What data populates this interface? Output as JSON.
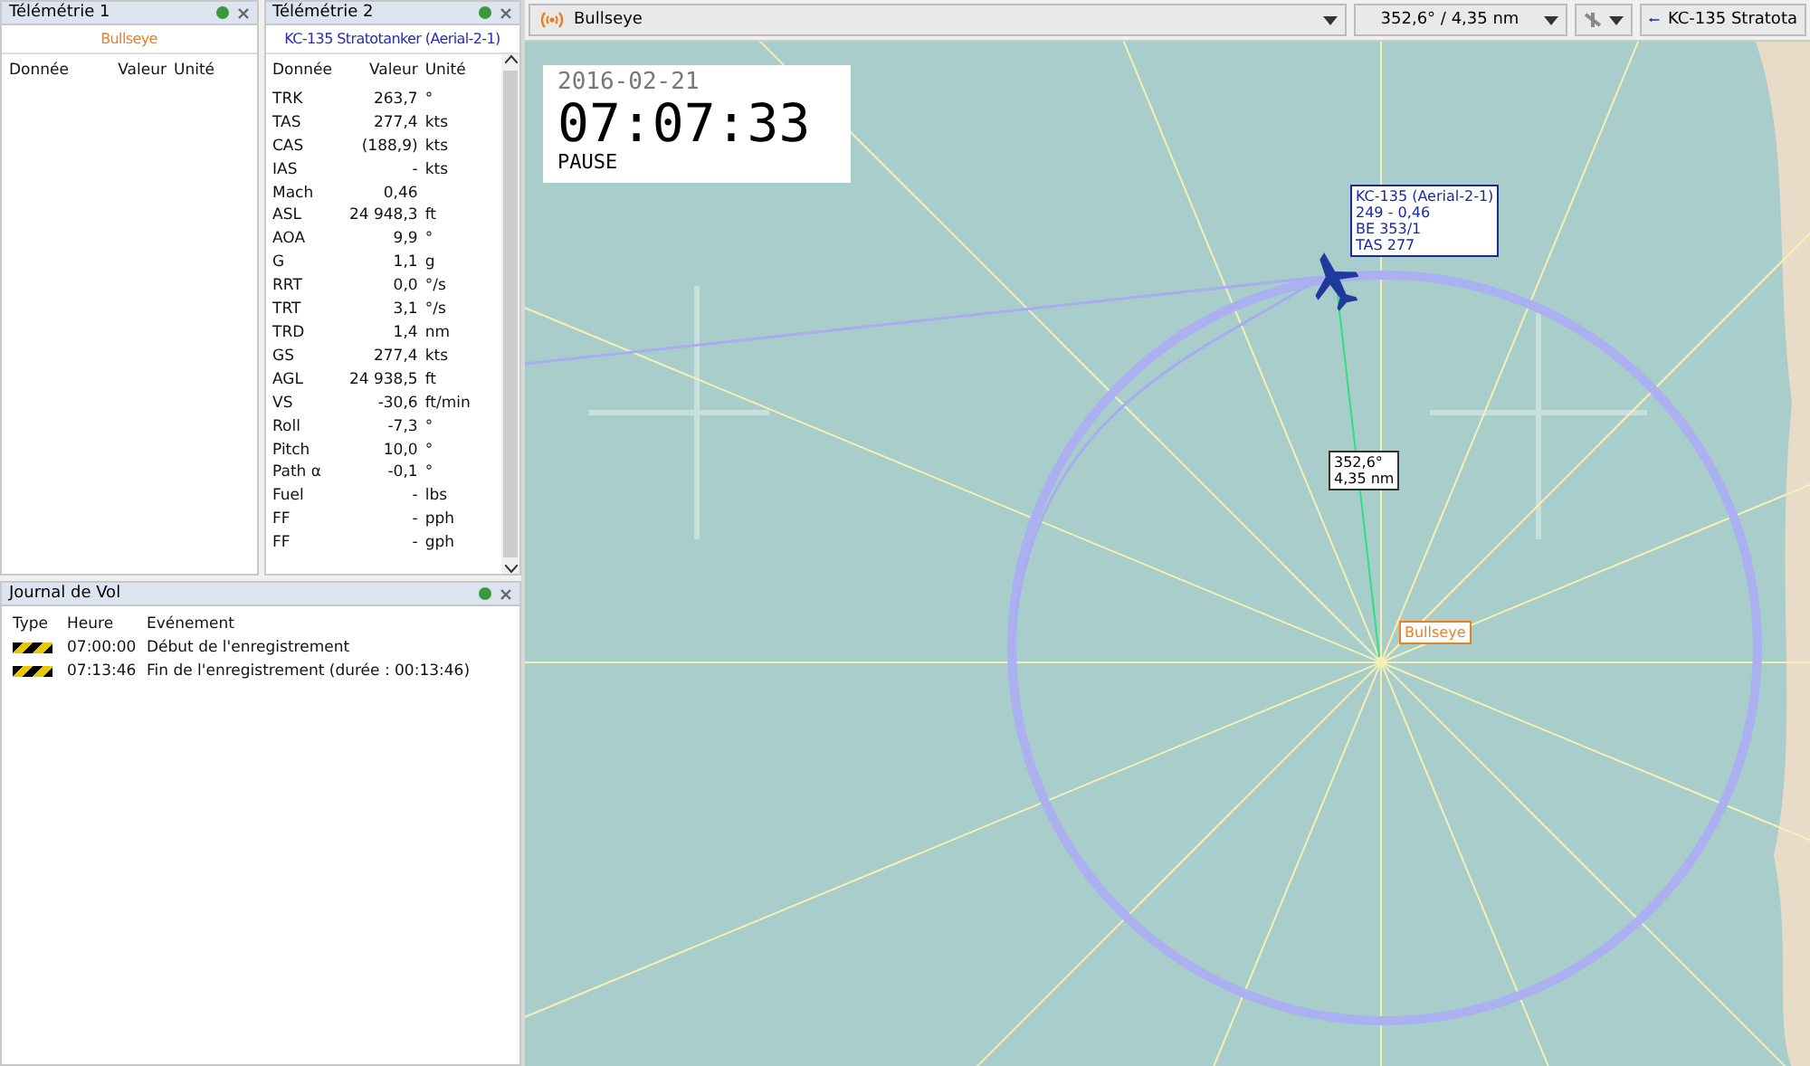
{
  "telemetry_1": {
    "title": "Télémétrie 1",
    "target": "Bullseye",
    "columns": [
      "Donnée",
      "Valeur",
      "Unité"
    ]
  },
  "telemetry_2": {
    "title": "Télémétrie 2",
    "target": "KC-135 Stratotanker (Aerial-2-1)",
    "columns": [
      "Donnée",
      "Valeur",
      "Unité"
    ],
    "rows": [
      {
        "data": "TRK",
        "value": "263,7",
        "unit": "°"
      },
      {
        "data": "TAS",
        "value": "277,4",
        "unit": "kts"
      },
      {
        "data": "CAS",
        "value": "(188,9)",
        "unit": "kts"
      },
      {
        "data": "IAS",
        "value": "-",
        "unit": "kts"
      },
      {
        "data": "Mach",
        "value": "0,46",
        "unit": ""
      },
      {
        "data": "ASL",
        "value": "24 948,3",
        "unit": "ft"
      },
      {
        "data": "AOA",
        "value": "9,9",
        "unit": "°"
      },
      {
        "data": "G",
        "value": "1,1",
        "unit": "g"
      },
      {
        "data": "RRT",
        "value": "0,0",
        "unit": "°/s"
      },
      {
        "data": "TRT",
        "value": "3,1",
        "unit": "°/s"
      },
      {
        "data": "TRD",
        "value": "1,4",
        "unit": "nm"
      },
      {
        "data": "GS",
        "value": "277,4",
        "unit": "kts"
      },
      {
        "data": "AGL",
        "value": "24 938,5",
        "unit": "ft"
      },
      {
        "data": "VS",
        "value": "-30,6",
        "unit": "ft/min"
      },
      {
        "data": "Roll",
        "value": "-7,3",
        "unit": "°"
      },
      {
        "data": "Pitch",
        "value": "10,0",
        "unit": "°"
      },
      {
        "data": "Path α",
        "value": "-0,1",
        "unit": "°"
      },
      {
        "data": "Fuel",
        "value": "-",
        "unit": "lbs"
      },
      {
        "data": "FF",
        "value": "-",
        "unit": "pph"
      },
      {
        "data": "FF",
        "value": "-",
        "unit": "gph"
      }
    ]
  },
  "flight_log": {
    "title": "Journal de Vol",
    "columns": [
      "Type",
      "Heure",
      "Evénement"
    ],
    "rows": [
      {
        "time": "07:00:00",
        "event": "Début de l'enregistrement"
      },
      {
        "time": "07:13:46",
        "event": "Fin de l'enregistrement (durée : 00:13:46)"
      }
    ]
  },
  "toolbar": {
    "reference": "Bullseye",
    "bearing": "352,6° / 4,35 nm",
    "aircraft": "KC-135 Stratota"
  },
  "clock": {
    "date": "2016-02-21",
    "time": "07:07:33",
    "status": "PAUSE"
  },
  "map": {
    "aircraft_label": [
      "KC-135 (Aerial-2-1)",
      "249 - 0,46",
      "BE 353/1",
      "TAS 277"
    ],
    "range_label": [
      "352,6°",
      "4,35 nm"
    ],
    "bullseye_label": "Bullseye"
  }
}
